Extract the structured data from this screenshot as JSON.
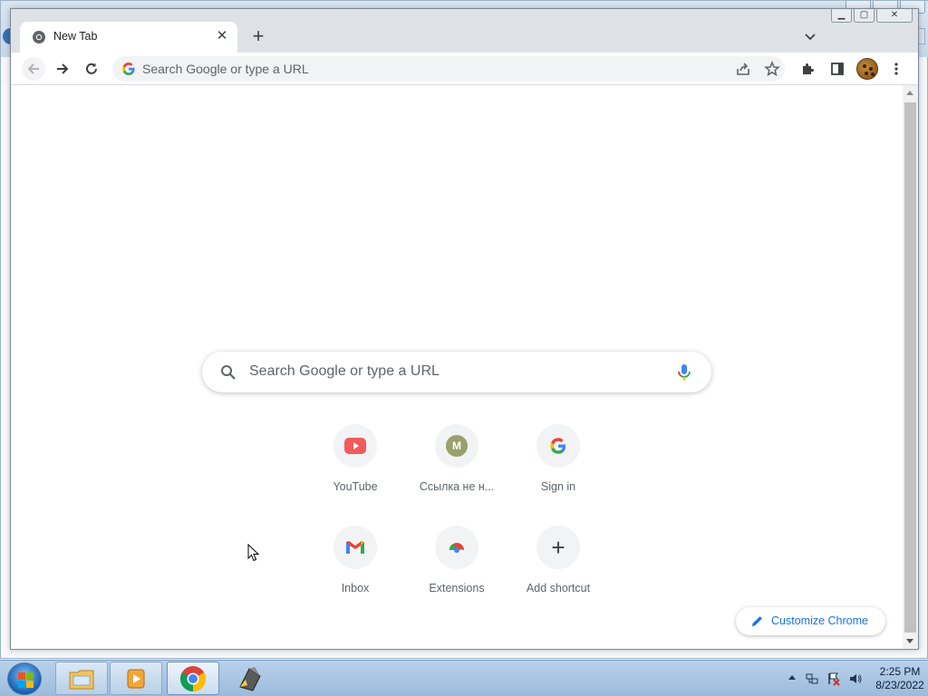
{
  "browser": {
    "tab": {
      "title": "New Tab",
      "close_icon": "close-icon"
    },
    "new_tab_icon": "plus-icon",
    "window_controls": [
      "minimize",
      "restore",
      "close"
    ],
    "omnibox": {
      "placeholder": "Search Google or type a URL"
    }
  },
  "ntp": {
    "search": {
      "placeholder": "Search Google or type a URL"
    },
    "shortcuts": [
      {
        "label": "YouTube",
        "icon": "youtube-icon"
      },
      {
        "label": "Ссылка не н...",
        "icon": "m-letter-icon",
        "letter": "M"
      },
      {
        "label": "Sign in",
        "icon": "google-g-icon"
      },
      {
        "label": "Inbox",
        "icon": "gmail-icon"
      },
      {
        "label": "Extensions",
        "icon": "chrome-web-store-icon"
      },
      {
        "label": "Add shortcut",
        "icon": "plus-icon"
      }
    ],
    "customize_label": "Customize Chrome"
  },
  "taskbar": {
    "apps": [
      "file-explorer",
      "media-player",
      "chrome",
      "app-icon"
    ],
    "clock": {
      "time": "2:25 PM",
      "date": "8/23/2022"
    }
  },
  "colors": {
    "accent": "#1a73e8",
    "tab_strip": "#dee1e6",
    "taskbar": "#b9d1ea"
  }
}
